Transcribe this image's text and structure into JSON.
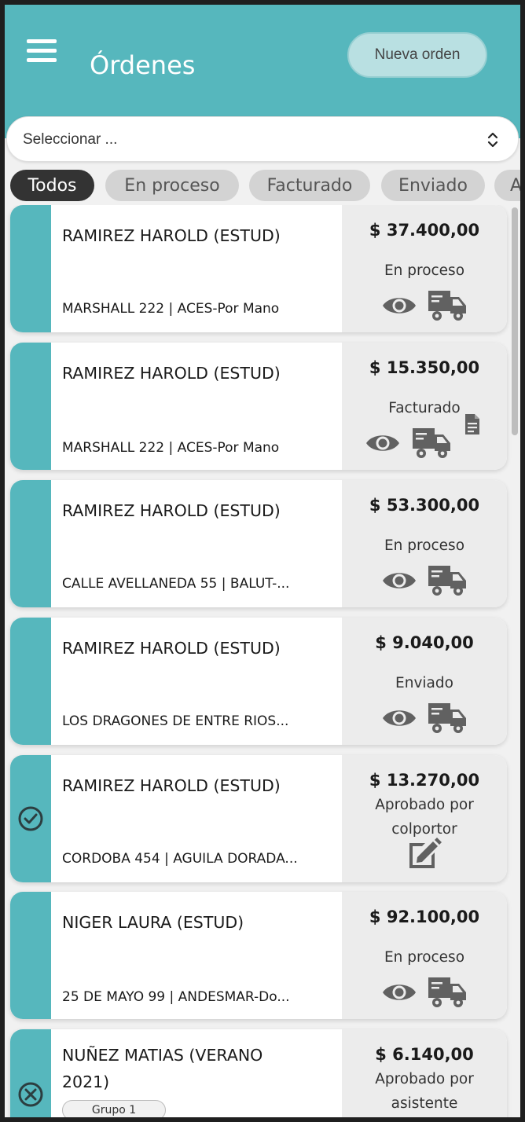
{
  "header": {
    "title": "Órdenes",
    "new_order_label": "Nueva orden",
    "menu_icon": "hamburger-menu-icon"
  },
  "select": {
    "placeholder": "Seleccionar ..."
  },
  "filters": [
    "Todos",
    "En proceso",
    "Facturado",
    "Enviado",
    "A"
  ],
  "orders": [
    {
      "name": "RAMIREZ HAROLD (ESTUD)",
      "address": "MARSHALL 222 | ACES-Por Mano",
      "amount": "$ 37.400,00",
      "status": "En proceso",
      "icons": [
        "eye-icon",
        "truck-icon"
      ],
      "strip_icon": ""
    },
    {
      "name": "RAMIREZ HAROLD (ESTUD)",
      "address": "MARSHALL 222 | ACES-Por Mano",
      "amount": "$ 15.350,00",
      "status": "Facturado",
      "icons": [
        "eye-icon",
        "truck-icon",
        "document-icon"
      ],
      "strip_icon": ""
    },
    {
      "name": "RAMIREZ HAROLD (ESTUD)",
      "address": "CALLE AVELLANEDA 55 | BALUT-...",
      "amount": "$ 53.300,00",
      "status": "En proceso",
      "icons": [
        "eye-icon",
        "truck-icon"
      ],
      "strip_icon": ""
    },
    {
      "name": "RAMIREZ HAROLD (ESTUD)",
      "address": "LOS DRAGONES DE ENTRE RIOS...",
      "amount": "$ 9.040,00",
      "status": "Enviado",
      "icons": [
        "eye-icon",
        "truck-icon"
      ],
      "strip_icon": ""
    },
    {
      "name": "RAMIREZ HAROLD (ESTUD)",
      "address": "CORDOBA 454 | AGUILA DORADA...",
      "amount": "$ 13.270,00",
      "status": "Aprobado por colportor",
      "icons": [
        "edit-icon"
      ],
      "strip_icon": "check-circle-icon"
    },
    {
      "name": "NIGER LAURA (ESTUD)",
      "address": "25 DE MAYO 99 | ANDESMAR-Do...",
      "amount": "$ 92.100,00",
      "status": "En proceso",
      "icons": [
        "eye-icon",
        "truck-icon"
      ],
      "strip_icon": ""
    },
    {
      "name": "NUÑEZ MATIAS (VERANO 2021)",
      "badge": "Grupo 1",
      "address": "",
      "amount": "$ 6.140,00",
      "status": "Aprobado por asistente",
      "icons": [],
      "strip_icon": "cancel-circle-icon"
    }
  ],
  "colors": {
    "accent": "#56b7bd",
    "active_chip": "#333333",
    "icon_gray": "#616161"
  }
}
